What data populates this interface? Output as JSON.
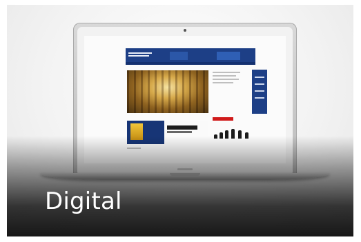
{
  "tile": {
    "caption": "Digital",
    "image_subject": "laptop-displaying-website"
  },
  "colors": {
    "site_primary": "#1d3f86",
    "accent_red": "#d01a1a",
    "caption_text": "#ffffff"
  }
}
